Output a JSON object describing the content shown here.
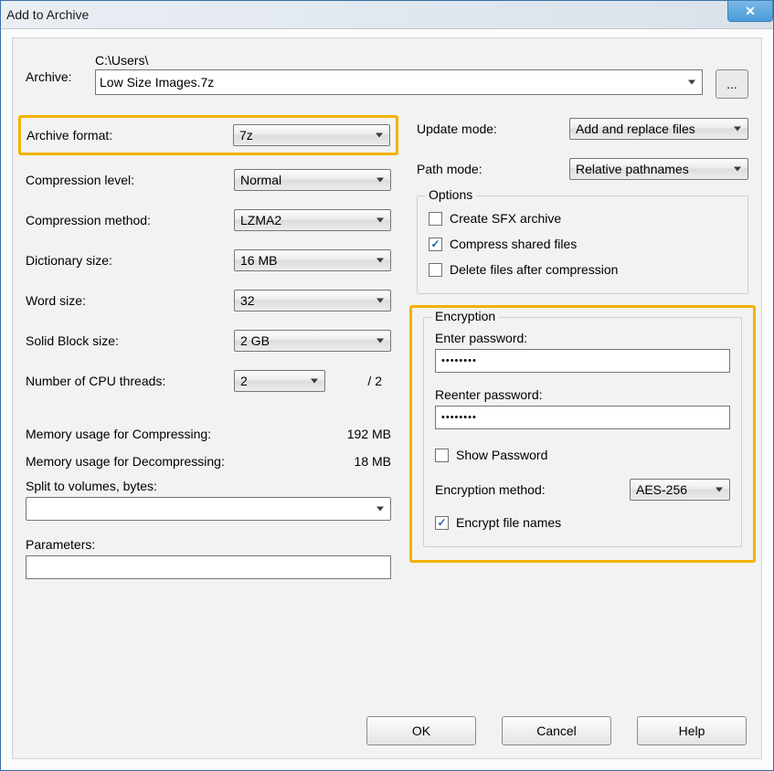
{
  "title": "Add to Archive",
  "archive": {
    "label": "Archive:",
    "path_prefix": "C:\\Users\\",
    "filename": "Low Size Images.7z",
    "browse": "..."
  },
  "left": {
    "format_label": "Archive format:",
    "format_value": "7z",
    "level_label": "Compression level:",
    "level_value": "Normal",
    "method_label": "Compression method:",
    "method_value": "LZMA2",
    "dict_label": "Dictionary size:",
    "dict_value": "16 MB",
    "word_label": "Word size:",
    "word_value": "32",
    "block_label": "Solid Block size:",
    "block_value": "2 GB",
    "threads_label": "Number of CPU threads:",
    "threads_value": "2",
    "threads_total": "/ 2",
    "mem_comp_label": "Memory usage for Compressing:",
    "mem_comp_value": "192 MB",
    "mem_decomp_label": "Memory usage for Decompressing:",
    "mem_decomp_value": "18 MB",
    "split_label": "Split to volumes, bytes:",
    "split_value": "",
    "params_label": "Parameters:",
    "params_value": ""
  },
  "right": {
    "update_label": "Update mode:",
    "update_value": "Add and replace files",
    "path_label": "Path mode:",
    "path_value": "Relative pathnames",
    "options": {
      "legend": "Options",
      "sfx": "Create SFX archive",
      "sfx_checked": false,
      "shared": "Compress shared files",
      "shared_checked": true,
      "delete": "Delete files after compression",
      "delete_checked": false
    },
    "enc": {
      "legend": "Encryption",
      "enter_label": "Enter password:",
      "enter_value": "••••••••",
      "reenter_label": "Reenter password:",
      "reenter_value": "••••••••",
      "show_label": "Show Password",
      "show_checked": false,
      "method_label": "Encryption method:",
      "method_value": "AES-256",
      "names_label": "Encrypt file names",
      "names_checked": true
    }
  },
  "buttons": {
    "ok": "OK",
    "cancel": "Cancel",
    "help": "Help"
  }
}
